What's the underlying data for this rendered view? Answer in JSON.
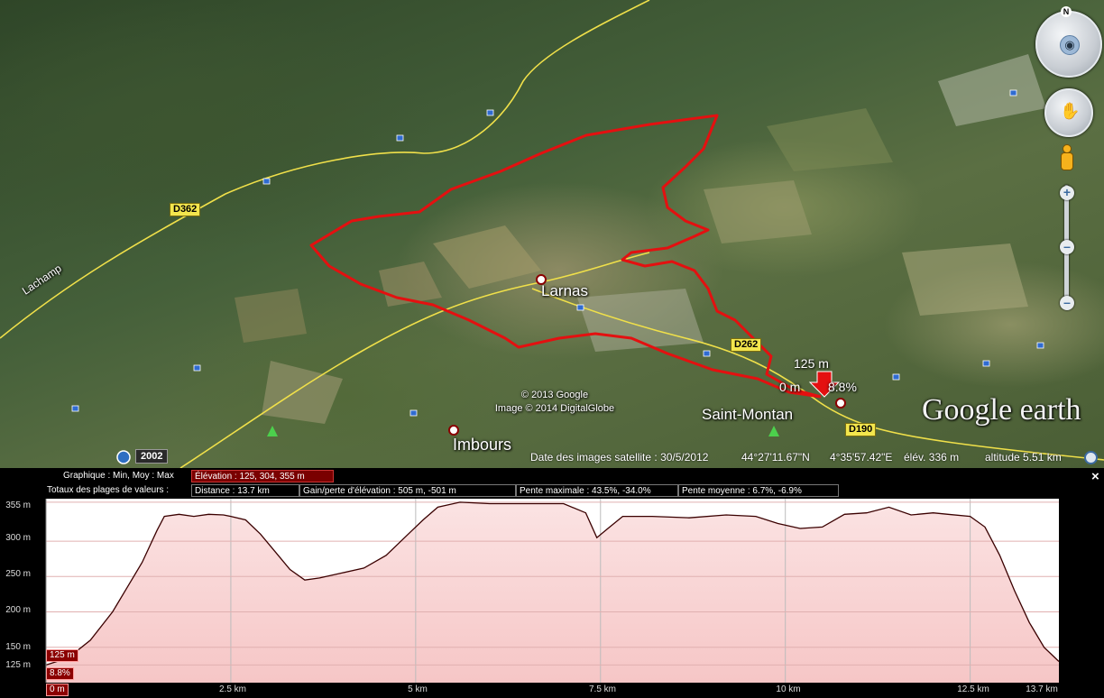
{
  "map": {
    "places": {
      "larnas": "Larnas",
      "saint_montan": "Saint-Montan",
      "imbours": "Imbours",
      "lachamp": "Lachamp"
    },
    "roads": {
      "d362_a": "D362",
      "d262": "D262",
      "d190": "D190"
    },
    "copyright": {
      "line1": "© 2013 Google",
      "line2": "Image © 2014 DigitalGlobe"
    },
    "logo": "Google earth",
    "marker": {
      "elev": "125 m",
      "dist": "0 m",
      "slope": "8.8%"
    },
    "historical_year": "2002",
    "status": {
      "imagery_date": "Date des images satellite : 30/5/2012",
      "lat": "44°27'11.67\"N",
      "lon": "4°35'57.42\"E",
      "elev": "élév.  336 m",
      "altitude": "altitude   5.51 km"
    },
    "compass_n": "N"
  },
  "panel": {
    "graph_label": "Graphique : Min, Moy : Max",
    "elevation_box": "Élévation : 125, 304, 355 m",
    "totals_label": "Totaux des plages de valeurs :",
    "distance_box": "Distance : 13.7 km",
    "gain_box": "Gain/perte d'élévation : 505 m, -501 m",
    "slope_max_box": "Pente maximale : 43.5%, -34.0%",
    "slope_avg_box": "Pente moyenne : 6.7%, -6.9%",
    "close": "×",
    "tags": {
      "elev": "125 m",
      "slope": "8.8%",
      "dist": "0 m"
    }
  },
  "chart_data": {
    "type": "area",
    "xlabel": "",
    "ylabel": "",
    "y_ticks": [
      "355 m",
      "300 m",
      "250 m",
      "200 m",
      "150 m",
      "125 m"
    ],
    "x_ticks": [
      "2.5 km",
      "5 km",
      "7.5 km",
      "10 km",
      "12.5 km",
      "13.7 km"
    ],
    "xlim": [
      0,
      13.7
    ],
    "ylim": [
      125,
      355
    ],
    "grid": true,
    "fill_color": "#f6c6c6",
    "line_color": "#3a0000",
    "x": [
      0,
      0.3,
      0.6,
      0.9,
      1.1,
      1.3,
      1.5,
      1.6,
      1.8,
      2.0,
      2.2,
      2.4,
      2.5,
      2.7,
      2.9,
      3.1,
      3.3,
      3.5,
      3.7,
      4.0,
      4.3,
      4.6,
      4.9,
      5.1,
      5.3,
      5.6,
      6.0,
      6.5,
      7.0,
      7.3,
      7.45,
      7.6,
      7.8,
      8.2,
      8.7,
      9.2,
      9.6,
      9.9,
      10.2,
      10.5,
      10.8,
      11.1,
      11.4,
      11.7,
      12.0,
      12.2,
      12.5,
      12.7,
      12.9,
      13.1,
      13.3,
      13.5,
      13.7
    ],
    "y": [
      125,
      135,
      160,
      200,
      235,
      270,
      315,
      335,
      338,
      335,
      338,
      337,
      335,
      330,
      310,
      285,
      260,
      245,
      248,
      255,
      262,
      280,
      310,
      330,
      348,
      355,
      353,
      353,
      353,
      340,
      305,
      318,
      335,
      335,
      333,
      337,
      335,
      325,
      318,
      320,
      338,
      340,
      348,
      337,
      340,
      338,
      335,
      320,
      280,
      230,
      185,
      150,
      130
    ]
  }
}
